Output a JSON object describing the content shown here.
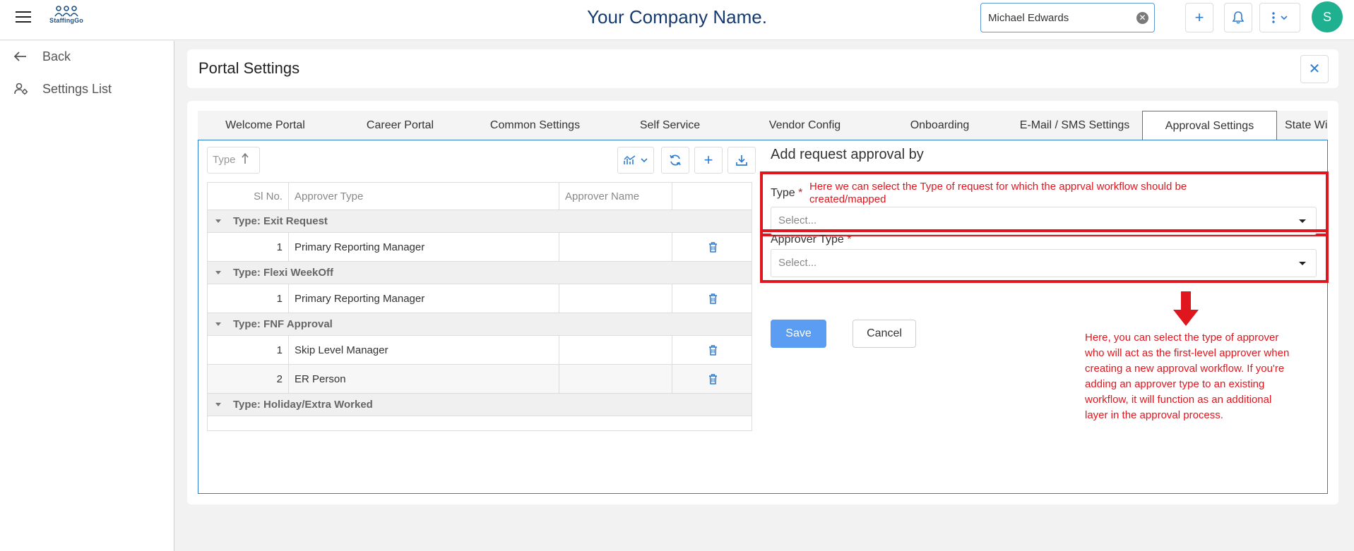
{
  "app": {
    "logo_text": "StaffingGo",
    "company_name": "Your Company Name.",
    "user_search_value": "Michael Edwards",
    "avatar_initial": "S"
  },
  "sidebar": {
    "back_label": "Back",
    "settings_list_label": "Settings List"
  },
  "page": {
    "title": "Portal Settings"
  },
  "tabs": [
    {
      "label": "Welcome Portal"
    },
    {
      "label": "Career Portal"
    },
    {
      "label": "Common Settings"
    },
    {
      "label": "Self Service"
    },
    {
      "label": "Vendor Config"
    },
    {
      "label": "Onboarding"
    },
    {
      "label": "E-Mail / SMS Settings"
    },
    {
      "label": "Approval Settings",
      "active": true
    },
    {
      "label": "State Wi"
    }
  ],
  "grid": {
    "group_chip": "Type",
    "columns": {
      "sl_no": "Sl No.",
      "approver_type": "Approver Type",
      "approver_name": "Approver Name"
    },
    "groups": [
      {
        "label": "Type: Exit Request",
        "rows": [
          {
            "sl": "1",
            "approver_type": "Primary Reporting Manager",
            "approver_name": ""
          }
        ]
      },
      {
        "label": "Type: Flexi WeekOff",
        "rows": [
          {
            "sl": "1",
            "approver_type": "Primary Reporting Manager",
            "approver_name": ""
          }
        ]
      },
      {
        "label": "Type: FNF Approval",
        "rows": [
          {
            "sl": "1",
            "approver_type": "Skip Level Manager",
            "approver_name": ""
          },
          {
            "sl": "2",
            "approver_type": "ER Person",
            "approver_name": ""
          }
        ]
      },
      {
        "label": "Type: Holiday/Extra Worked",
        "rows": []
      }
    ]
  },
  "form": {
    "title": "Add request approval by",
    "type_label": "Type",
    "approver_type_label": "Approver Type",
    "required_mark": "*",
    "type_placeholder": "Select...",
    "approver_type_placeholder": "Select...",
    "save_label": "Save",
    "cancel_label": "Cancel"
  },
  "annotations": {
    "type_note_line1": "Here we can select the Type of request for which the apprval workflow should be",
    "type_note_line2": "created/mapped",
    "approver_note_lines": [
      "Here, you can select the type of approver",
      "who will act as the first-level approver when",
      "creating a new approval workflow. If you're",
      "adding an approver type to an existing",
      "workflow, it will function as an additional",
      "layer in the approval process."
    ],
    "color": "#e0161f"
  },
  "colors": {
    "accent": "#2b7cd3",
    "save_button": "#5b9df2",
    "avatar": "#1fb08f",
    "title_text": "#163a6e"
  }
}
